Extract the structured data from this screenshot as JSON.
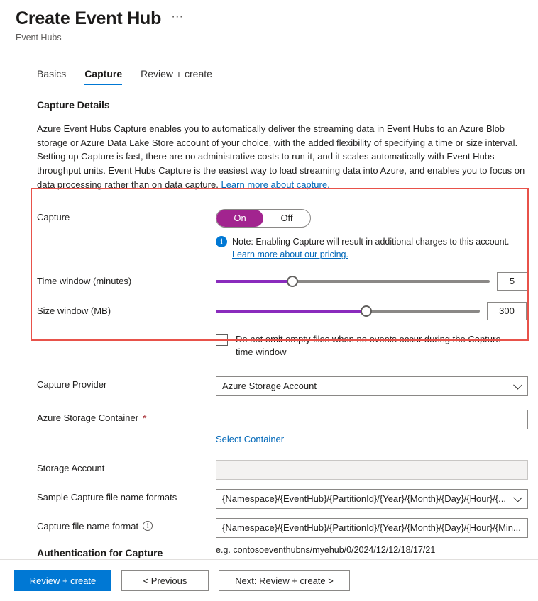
{
  "header": {
    "title": "Create Event Hub",
    "subtitle": "Event Hubs",
    "more_label": "⋯"
  },
  "tabs": [
    {
      "label": "Basics",
      "active": false
    },
    {
      "label": "Capture",
      "active": true
    },
    {
      "label": "Review + create",
      "active": false
    }
  ],
  "capture_details": {
    "heading": "Capture Details",
    "description": "Azure Event Hubs Capture enables you to automatically deliver the streaming data in Event Hubs to an Azure Blob storage or Azure Data Lake Store account of your choice, with the added flexibility of specifying a time or size interval. Setting up Capture is fast, there are no administrative costs to run it, and it scales automatically with Event Hubs throughput units. Event Hubs Capture is the easiest way to load streaming data into Azure, and enables you to focus on data processing rather than on data capture.",
    "description_link": "Learn more about capture."
  },
  "capture_toggle": {
    "label": "Capture",
    "on_label": "On",
    "off_label": "Off",
    "selected": "On",
    "note_text": "Note: Enabling Capture will result in additional charges to this account.",
    "note_link": "Learn more about our pricing.",
    "info_icon": "info-filled-icon"
  },
  "time_window": {
    "label": "Time window (minutes)",
    "value": "5",
    "percent": 28
  },
  "size_window": {
    "label": "Size window (MB)",
    "value": "300",
    "percent": 57
  },
  "empty_files_checkbox": {
    "label": "Do not emit empty files when no events occur during the Capture time window",
    "checked": false
  },
  "capture_provider": {
    "label": "Capture Provider",
    "value": "Azure Storage Account",
    "icon": "chevron-down-icon"
  },
  "storage_container": {
    "label": "Azure Storage Container",
    "required_marker": "*",
    "value": "",
    "select_link": "Select Container"
  },
  "storage_account": {
    "label": "Storage Account",
    "value": ""
  },
  "sample_file_formats": {
    "label": "Sample Capture file name formats",
    "value": "{Namespace}/{EventHub}/{PartitionId}/{Year}/{Month}/{Day}/{Hour}/{...",
    "icon": "chevron-down-icon"
  },
  "capture_file_name_format": {
    "label": "Capture file name format",
    "info_icon": "info-outline-icon",
    "value": "{Namespace}/{EventHub}/{PartitionId}/{Year}/{Month}/{Day}/{Hour}/{Min...",
    "example": "e.g. contosoeventhubns/myehub/0/2024/12/12/18/17/21"
  },
  "authentication_section": {
    "heading": "Authentication for Capture"
  },
  "footer": {
    "review_create": "Review + create",
    "previous": "< Previous",
    "next": "Next: Review + create >"
  },
  "colors": {
    "accent_blue": "#0078d4",
    "link_blue": "#0067b8",
    "toggle_purple": "#a2248f",
    "slider_purple": "#8a2bbd",
    "highlight_red": "#e8524a",
    "required_red": "#a4262c"
  }
}
